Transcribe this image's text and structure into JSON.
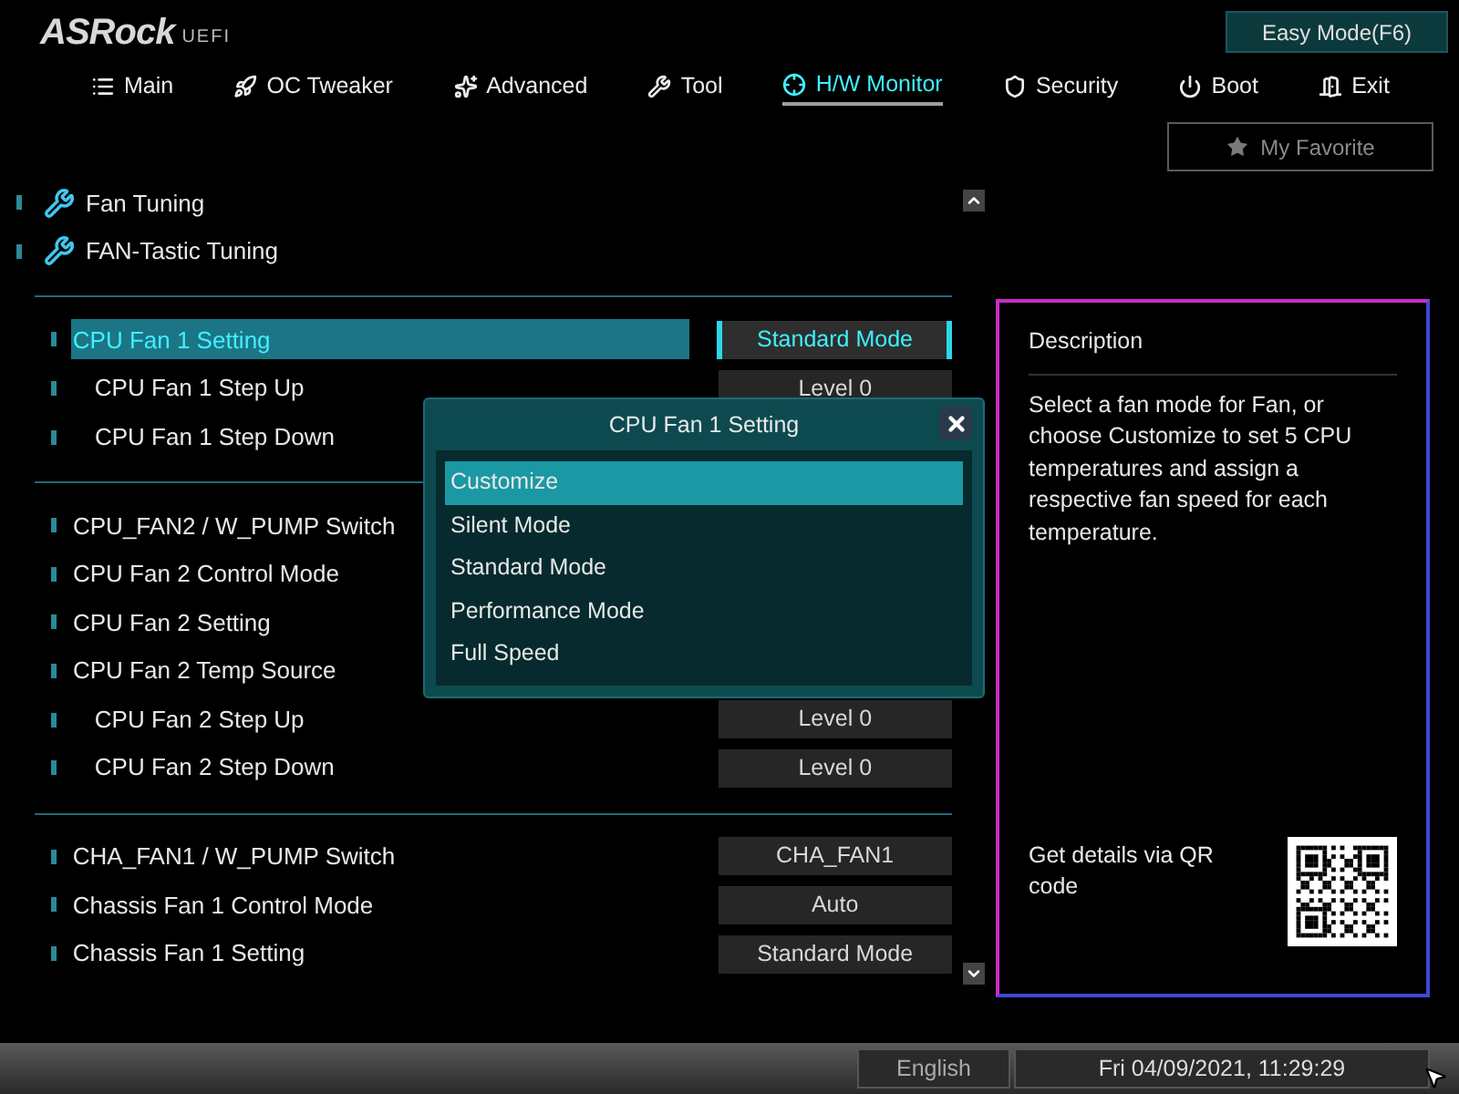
{
  "header": {
    "logo": "ASRock",
    "logo_suffix": "UEFI",
    "mode_button": "Easy Mode(F6)"
  },
  "tabs": [
    {
      "label": "Main",
      "selected": false
    },
    {
      "label": "OC Tweaker",
      "selected": false
    },
    {
      "label": "Advanced",
      "selected": false
    },
    {
      "label": "Tool",
      "selected": false
    },
    {
      "label": "H/W Monitor",
      "selected": true
    },
    {
      "label": "Security",
      "selected": false
    },
    {
      "label": "Boot",
      "selected": false
    },
    {
      "label": "Exit",
      "selected": false
    }
  ],
  "favorite_button": "My Favorite",
  "tools": [
    {
      "label": "Fan Tuning"
    },
    {
      "label": "FAN-Tastic Tuning"
    }
  ],
  "groups": [
    {
      "rows": [
        {
          "label": "CPU Fan 1 Setting",
          "kind": "item",
          "selected": true,
          "value": "Standard Mode"
        },
        {
          "label": "CPU Fan 1 Step Up",
          "kind": "sub",
          "selected": false,
          "value": "Level 0"
        },
        {
          "label": "CPU Fan 1 Step Down",
          "kind": "sub",
          "selected": false
        }
      ]
    },
    {
      "rows": [
        {
          "label": "CPU_FAN2 / W_PUMP Switch",
          "kind": "item",
          "selected": false
        },
        {
          "label": "CPU Fan 2 Control Mode",
          "kind": "item",
          "selected": false
        },
        {
          "label": "CPU Fan 2 Setting",
          "kind": "item",
          "selected": false
        },
        {
          "label": "CPU Fan 2 Temp Source",
          "kind": "item",
          "selected": false
        },
        {
          "label": "CPU Fan 2 Step Up",
          "kind": "sub",
          "selected": false,
          "value": "Level 0"
        },
        {
          "label": "CPU Fan 2 Step Down",
          "kind": "sub",
          "selected": false,
          "value": "Level 0"
        }
      ]
    },
    {
      "rows": [
        {
          "label": "CHA_FAN1 / W_PUMP Switch",
          "kind": "item",
          "selected": false,
          "value": "CHA_FAN1"
        },
        {
          "label": "Chassis Fan 1 Control Mode",
          "kind": "item",
          "selected": false,
          "value": "Auto"
        },
        {
          "label": "Chassis Fan 1 Setting",
          "kind": "item",
          "selected": false,
          "value": "Standard Mode"
        }
      ]
    }
  ],
  "dialog": {
    "title": "CPU Fan 1 Setting",
    "options": [
      {
        "label": "Customize",
        "selected": true
      },
      {
        "label": "Silent Mode",
        "selected": false
      },
      {
        "label": "Standard Mode",
        "selected": false
      },
      {
        "label": "Performance Mode",
        "selected": false
      },
      {
        "label": "Full Speed",
        "selected": false
      }
    ]
  },
  "description": {
    "title": "Description",
    "text": "Select a fan mode for Fan, or choose Customize to set 5 CPU temperatures and assign a respective fan speed for each temperature.",
    "qr_text": "Get details via QR code"
  },
  "status_bar": {
    "language": "English",
    "datetime": "Fri 04/09/2021, 11:29:29"
  }
}
